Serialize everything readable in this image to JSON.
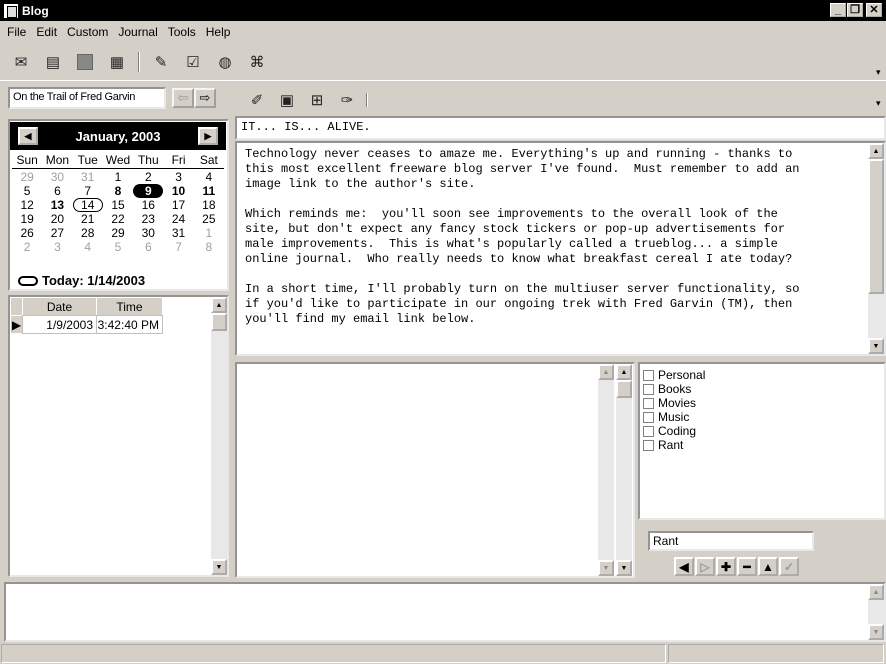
{
  "window": {
    "title": "Blog"
  },
  "menu": [
    "File",
    "Edit",
    "Custom",
    "Journal",
    "Tools",
    "Help"
  ],
  "journal_select": {
    "value": "On the Trail of Fred Garvin"
  },
  "calendar": {
    "month_label": "January, 2003",
    "days_of_week": [
      "Sun",
      "Mon",
      "Tue",
      "Wed",
      "Thu",
      "Fri",
      "Sat"
    ],
    "days": [
      {
        "d": "29",
        "s": "dim"
      },
      {
        "d": "30",
        "s": "dim"
      },
      {
        "d": "31",
        "s": "dim"
      },
      {
        "d": "1",
        "s": ""
      },
      {
        "d": "2",
        "s": ""
      },
      {
        "d": "3",
        "s": ""
      },
      {
        "d": "4",
        "s": ""
      },
      {
        "d": "5",
        "s": ""
      },
      {
        "d": "6",
        "s": ""
      },
      {
        "d": "7",
        "s": ""
      },
      {
        "d": "8",
        "s": "bold"
      },
      {
        "d": "9",
        "s": "sel"
      },
      {
        "d": "10",
        "s": "bold"
      },
      {
        "d": "11",
        "s": "bold"
      },
      {
        "d": "12",
        "s": ""
      },
      {
        "d": "13",
        "s": "bold"
      },
      {
        "d": "14",
        "s": "ring"
      },
      {
        "d": "15",
        "s": ""
      },
      {
        "d": "16",
        "s": ""
      },
      {
        "d": "17",
        "s": ""
      },
      {
        "d": "18",
        "s": ""
      },
      {
        "d": "19",
        "s": ""
      },
      {
        "d": "20",
        "s": ""
      },
      {
        "d": "21",
        "s": ""
      },
      {
        "d": "22",
        "s": ""
      },
      {
        "d": "23",
        "s": ""
      },
      {
        "d": "24",
        "s": ""
      },
      {
        "d": "25",
        "s": ""
      },
      {
        "d": "26",
        "s": ""
      },
      {
        "d": "27",
        "s": ""
      },
      {
        "d": "28",
        "s": ""
      },
      {
        "d": "29",
        "s": ""
      },
      {
        "d": "30",
        "s": ""
      },
      {
        "d": "31",
        "s": ""
      },
      {
        "d": "1",
        "s": "dim"
      },
      {
        "d": "2",
        "s": "dim"
      },
      {
        "d": "3",
        "s": "dim"
      },
      {
        "d": "4",
        "s": "dim"
      },
      {
        "d": "5",
        "s": "dim"
      },
      {
        "d": "6",
        "s": "dim"
      },
      {
        "d": "7",
        "s": "dim"
      },
      {
        "d": "8",
        "s": "dim"
      }
    ],
    "today_label": "Today: 1/14/2003"
  },
  "entries": {
    "columns": [
      "Date",
      "Time"
    ],
    "rows": [
      {
        "date": "1/9/2003",
        "time": "3:42:40 PM"
      }
    ]
  },
  "entry": {
    "title": "IT... IS... ALIVE.",
    "body": "Technology never ceases to amaze me. Everything's up and running - thanks to\nthis most excellent freeware blog server I've found.  Must remember to add an\nimage link to the author's site.\n\nWhich reminds me:  you'll soon see improvements to the overall look of the\nsite, but don't expect any fancy stock tickers or pop-up advertisements for\nmale improvements.  This is what's popularly called a trueblog... a simple\nonline journal.  Who really needs to know what breakfast cereal I ate today?\n\nIn a short time, I'll probably turn on the multiuser server functionality, so\nif you'd like to participate in our ongoing trek with Fred Garvin (TM), then\nyou'll find my email link below."
  },
  "categories": [
    "Personal",
    "Books",
    "Movies",
    "Music",
    "Coding",
    "Rant"
  ],
  "category_input": {
    "value": "Rant"
  },
  "icons": {
    "toolbar": [
      "new-icon",
      "open-icon",
      "stop-icon",
      "save-icon",
      "edit-icon",
      "check-icon",
      "globe-icon",
      "settings-icon"
    ],
    "toolbar2": [
      "link-icon",
      "image-icon",
      "table-icon",
      "format-icon"
    ]
  }
}
